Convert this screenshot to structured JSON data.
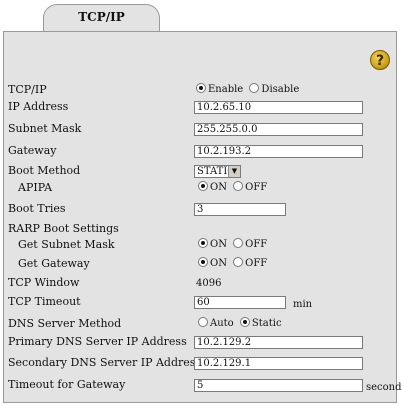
{
  "tab": {
    "label": "TCP/IP"
  },
  "help": {
    "glyph": "?"
  },
  "rows": {
    "tcpip": {
      "label": "TCP/IP",
      "options": [
        "Enable",
        "Disable"
      ],
      "selected": "Enable"
    },
    "ip_address": {
      "label": "IP Address",
      "value": "10.2.65.10"
    },
    "subnet_mask": {
      "label": "Subnet Mask",
      "value": "255.255.0.0"
    },
    "gateway": {
      "label": "Gateway",
      "value": "10.2.193.2"
    },
    "boot_method": {
      "label": "Boot Method",
      "value": "STATIC",
      "arrow": "▼"
    },
    "apipa": {
      "label": "APIPA",
      "options": [
        "ON",
        "OFF"
      ],
      "selected": "ON"
    },
    "boot_tries": {
      "label": "Boot Tries",
      "value": "3"
    },
    "rarp": {
      "label": "RARP Boot Settings"
    },
    "get_subnet_mask": {
      "label": "Get Subnet Mask",
      "options": [
        "ON",
        "OFF"
      ],
      "selected": "ON"
    },
    "get_gateway": {
      "label": "Get Gateway",
      "options": [
        "ON",
        "OFF"
      ],
      "selected": "ON"
    },
    "tcp_window": {
      "label": "TCP Window",
      "value": "4096"
    },
    "tcp_timeout": {
      "label": "TCP Timeout",
      "value": "60",
      "unit": "min"
    },
    "dns_method": {
      "label": "DNS Server Method",
      "options": [
        "Auto",
        "Static"
      ],
      "selected": "Static"
    },
    "primary_dns": {
      "label": "Primary DNS Server IP Address",
      "value": "10.2.129.2"
    },
    "secondary_dns": {
      "label": "Secondary DNS Server IP Address",
      "value": "10.2.129.1"
    },
    "timeout_gateway": {
      "label": "Timeout for Gateway",
      "value": "5",
      "unit": "seconds"
    }
  }
}
